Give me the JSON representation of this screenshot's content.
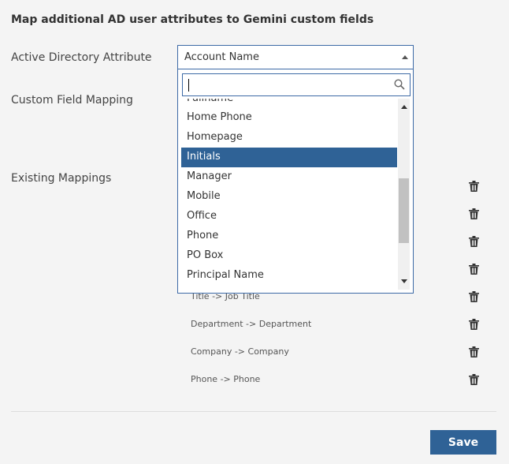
{
  "form": {
    "heading": "Map additional AD user attributes to Gemini custom fields",
    "ad_attribute_label": "Active Directory Attribute",
    "custom_field_label": "Custom Field Mapping",
    "existing_mappings_label": "Existing Mappings"
  },
  "select": {
    "selected_value": "Account Name",
    "search_value": "",
    "options": [
      "Fullname",
      "Home Phone",
      "Homepage",
      "Initials",
      "Manager",
      "Mobile",
      "Office",
      "Phone",
      "PO Box",
      "Principal Name"
    ],
    "highlighted_option": "Initials"
  },
  "mappings": [
    "Title -> Job Title",
    "Department -> Department",
    "Company -> Company",
    "Phone -> Phone"
  ],
  "actions": {
    "save_label": "Save"
  },
  "colors": {
    "accent": "#2f6296",
    "border": "#3d6aa6",
    "background": "#f4f4f4"
  },
  "icons": {
    "search": "search-icon",
    "delete": "trash-icon"
  }
}
